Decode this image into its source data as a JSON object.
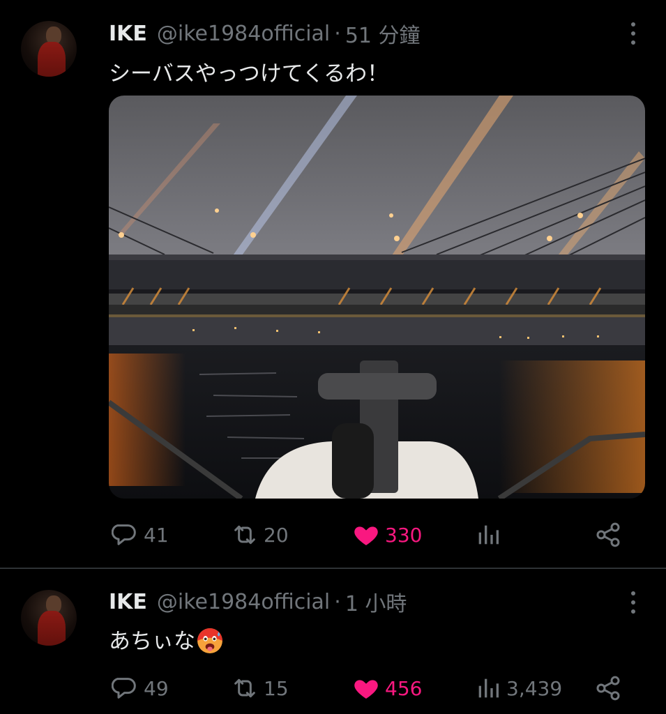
{
  "tweets": [
    {
      "author_name": "IKE",
      "handle": "@ike1984official",
      "separator": "·",
      "time": "51 分鐘",
      "text": "シーバスやっつけてくるわ！",
      "has_media": true,
      "stats": {
        "replies": "41",
        "retweets": "20",
        "likes": "330",
        "views": ""
      },
      "liked": true
    },
    {
      "author_name": "IKE",
      "handle": "@ike1984official",
      "separator": "·",
      "time": "1 小時",
      "text": "あちぃな",
      "emoji": "hot-face-emoji",
      "stats": {
        "replies": "49",
        "retweets": "15",
        "likes": "456",
        "views": "3,439"
      },
      "liked": true
    }
  ],
  "icons": {
    "reply": "comment-bubble-icon",
    "retweet": "retweet-icon",
    "like": "heart-icon",
    "views": "bar-chart-icon",
    "share": "share-icon",
    "more": "more-vertical-icon"
  },
  "colors": {
    "background": "#000000",
    "text_primary": "#e7e9ea",
    "text_secondary": "#71767b",
    "like_active": "#f91880",
    "divider": "#2f3336"
  }
}
